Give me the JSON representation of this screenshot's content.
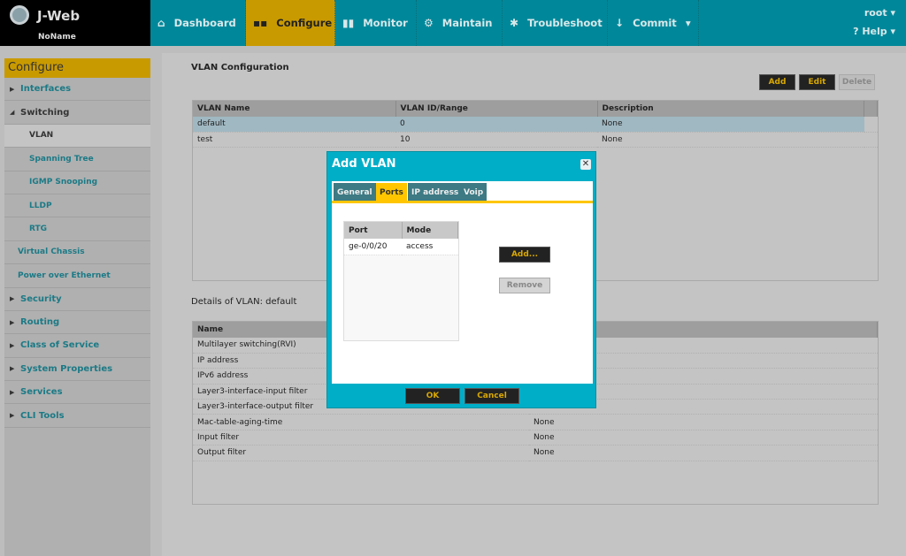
{
  "header": {
    "brand": "J-Web",
    "hostname": "NoName",
    "nav": [
      {
        "label": "Dashboard",
        "icon": "home-icon"
      },
      {
        "label": "Configure",
        "icon": "configure-icon"
      },
      {
        "label": "Monitor",
        "icon": "bar-chart-icon"
      },
      {
        "label": "Maintain",
        "icon": "gear-icon"
      },
      {
        "label": "Troubleshoot",
        "icon": "wrench-icon"
      },
      {
        "label": "Commit",
        "icon": "arrow-down-icon"
      }
    ],
    "user": "root",
    "help": "Help"
  },
  "sidebar": {
    "title": "Configure",
    "items": [
      "Interfaces",
      "Switching",
      "VLAN",
      "Spanning Tree",
      "IGMP Snooping",
      "LLDP",
      "RTG",
      "Virtual Chassis",
      "Power over Ethernet",
      "Security",
      "Routing",
      "Class of Service",
      "System Properties",
      "Services",
      "CLI Tools"
    ]
  },
  "main": {
    "title": "VLAN Configuration",
    "add": "Add",
    "edit": "Edit",
    "delete": "Delete",
    "vlan_table": {
      "columns": [
        "VLAN Name",
        "VLAN ID/Range",
        "Description"
      ],
      "rows": [
        [
          "default",
          "0",
          "None"
        ],
        [
          "test",
          "10",
          "None"
        ]
      ]
    },
    "details_title": "Details of VLAN: default",
    "details": {
      "columns": [
        "Name"
      ],
      "rows": [
        [
          "Multilayer switching(RVI)",
          ""
        ],
        [
          "IP address",
          ""
        ],
        [
          "IPv6 address",
          ""
        ],
        [
          "Layer3-interface-input filter",
          ""
        ],
        [
          "Layer3-interface-output filter",
          "None"
        ],
        [
          "Mac-table-aging-time",
          "None"
        ],
        [
          "Input filter",
          "None"
        ],
        [
          "Output filter",
          "None"
        ]
      ]
    }
  },
  "dialog": {
    "title": "Add VLAN",
    "tabs": [
      "General",
      "Ports",
      "IP address",
      "Voip"
    ],
    "active_tab": "Ports",
    "ports": {
      "columns": [
        "Port",
        "Mode"
      ],
      "rows": [
        [
          "ge-0/0/20",
          "access"
        ]
      ]
    },
    "add": "Add...",
    "remove": "Remove",
    "ok": "OK",
    "cancel": "Cancel"
  }
}
